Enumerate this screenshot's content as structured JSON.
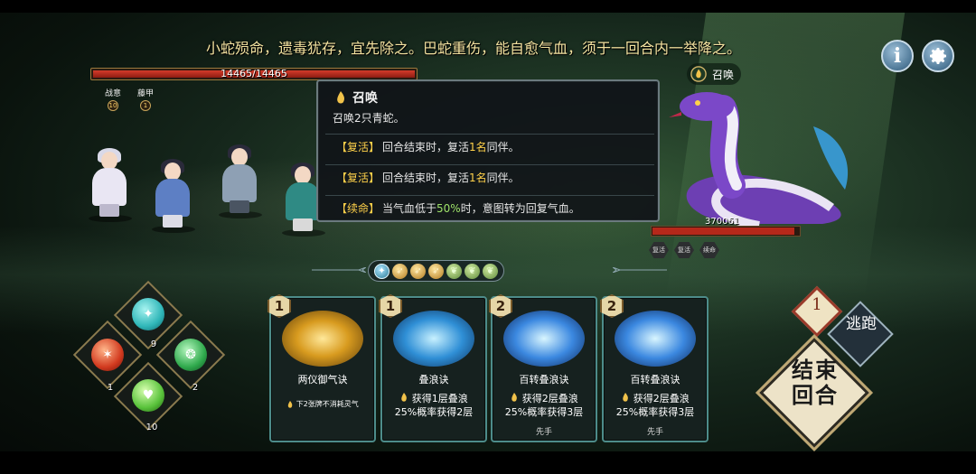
{
  "story_text": "小蛇殒命，遗毒犹存，宜先除之。巴蛇重伤，能自愈气血，须于一回合内一举降之。",
  "top_buttons": {
    "info_label": "i"
  },
  "player": {
    "hp_text": "14465/14465",
    "hp_fraction": 1.0,
    "statuses": [
      {
        "label": "战意",
        "count": "10"
      },
      {
        "label": "藤甲",
        "count": "1"
      }
    ]
  },
  "enemy": {
    "intent_label": "召唤",
    "hp_text": "370061",
    "hp_fraction": 0.97,
    "buffs": [
      "复活",
      "复活",
      "续命"
    ]
  },
  "tooltip": {
    "title": "召唤",
    "desc": "召唤2只青蛇。",
    "rows": [
      {
        "tag": "【复活】",
        "text_a": "回合结束时，复活",
        "hl": "1名",
        "text_b": "同伴。"
      },
      {
        "tag": "【复活】",
        "text_a": "回合结束时，复活",
        "hl": "1名",
        "text_b": "同伴。"
      },
      {
        "tag": "【续命】",
        "text_a": "当气血低于",
        "hl": "50%",
        "text_b": "时，意图转为回复气血。"
      }
    ]
  },
  "energy_orbs": [
    "cur",
    "wing",
    "wing",
    "wing",
    "leaf",
    "leaf",
    "leaf"
  ],
  "elements": [
    {
      "name": "water",
      "count": "9",
      "color": "#2fb6b8"
    },
    {
      "name": "fire",
      "count": "1",
      "color": "#d23a1f"
    },
    {
      "name": "wood",
      "count": "2",
      "color": "#2fa94c"
    },
    {
      "name": "earth",
      "count": "10",
      "color": "#58c23a"
    }
  ],
  "cards": [
    {
      "cost": "1",
      "name": "两仪御气诀",
      "line1": "下2张牌不消耗灵气",
      "line2": "",
      "line3": "",
      "first": ""
    },
    {
      "cost": "1",
      "name": "叠浪诀",
      "line1": "获得1层叠浪",
      "line2": "25%概率获得2层",
      "line3": "",
      "first": ""
    },
    {
      "cost": "2",
      "name": "百转叠浪诀",
      "line1": "获得2层叠浪",
      "line2": "25%概率获得3层",
      "line3": "",
      "first": "先手"
    },
    {
      "cost": "2",
      "name": "百转叠浪诀",
      "line1": "获得2层叠浪",
      "line2": "25%概率获得3层",
      "line3": "",
      "first": "先手"
    }
  ],
  "turn": {
    "number": "1",
    "flee_label": "逃跑",
    "end_label_1": "结束",
    "end_label_2": "回合"
  }
}
